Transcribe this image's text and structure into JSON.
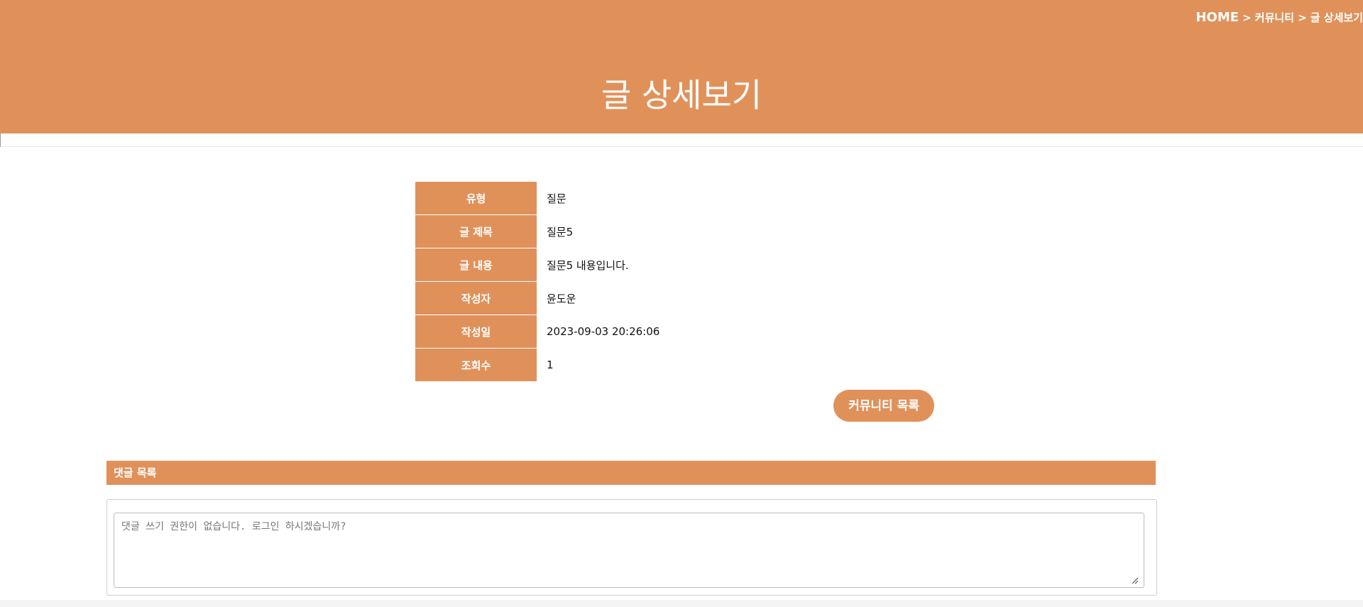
{
  "theme": {
    "accent": "#e0915a"
  },
  "breadcrumb": {
    "home": "HOME",
    "separator": ">",
    "items": [
      "커뮤니티",
      "글 상세보기"
    ]
  },
  "page": {
    "title": "글 상세보기"
  },
  "post": {
    "rows": [
      {
        "label": "유형",
        "value": "질문"
      },
      {
        "label": "글 제목",
        "value": "질문5"
      },
      {
        "label": "글 내용",
        "value": "질문5 내용입니다."
      },
      {
        "label": "작성자",
        "value": "윤도운"
      },
      {
        "label": "작성일",
        "value": "2023-09-03 20:26:06"
      },
      {
        "label": "조회수",
        "value": "1"
      }
    ]
  },
  "actions": {
    "list_button": "커뮤니티 목록"
  },
  "comments": {
    "header": "댓글 목록",
    "placeholder": "댓글 쓰기 권한이 없습니다. 로그인 하시겠습니까?",
    "resize_icon": "resize-handle-icon"
  }
}
